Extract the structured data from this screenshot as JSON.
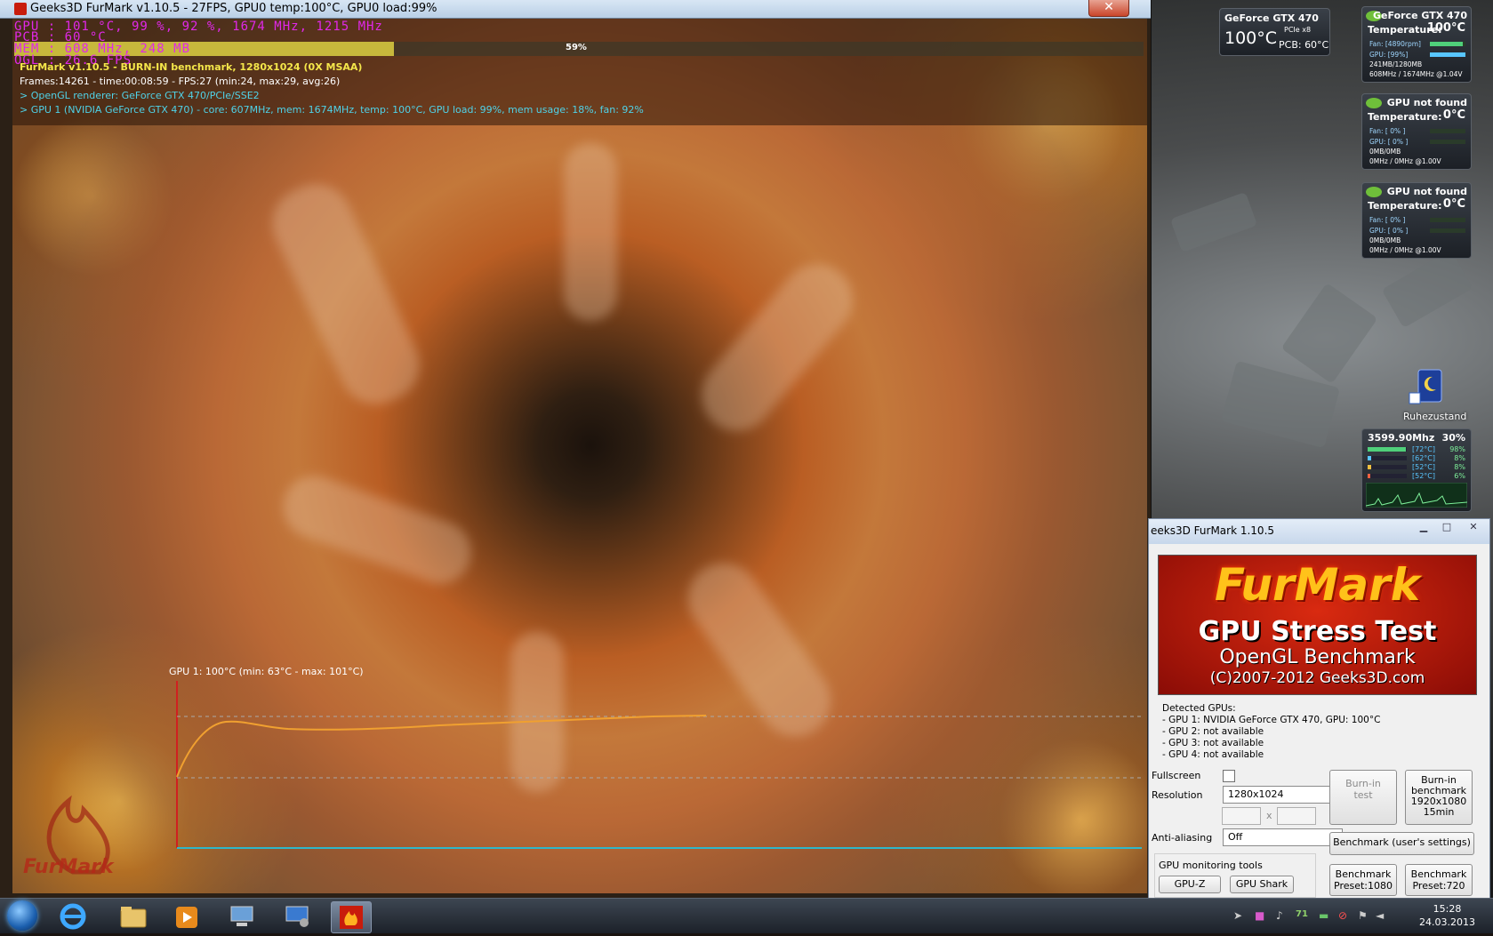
{
  "fm_window": {
    "title": "Geeks3D FurMark v1.10.5 - 27FPS, GPU0 temp:100°C, GPU0 load:99%",
    "close": "✕"
  },
  "osd": {
    "gpu": "GPU   :  101 °C,  99 %,  92 %,  1674 MHz,  1215 MHz",
    "pcb": "PCB   :  60 °C",
    "mem": "MEM   :  608 MHz,  248 MB",
    "mem_pct_label": "59%",
    "mem_pct": 59,
    "ogl": "OGL   :  26.6 FPS"
  },
  "info": {
    "line1": "FurMark v1.10.5 - BURN-IN benchmark, 1280x1024 (0X MSAA)",
    "line2": "Frames:14261 - time:00:08:59 - FPS:27 (min:24, max:29, avg:26)",
    "line3": "> OpenGL renderer: GeForce GTX 470/PCIe/SSE2",
    "line4": "> GPU 1 (NVIDIA GeForce GTX 470) - core: 607MHz, mem: 1674MHz, temp: 100°C, GPU load: 99%, mem usage: 18%, fan: 92%"
  },
  "graph": {
    "title": "GPU 1: 100°C (min: 63°C - max: 101°C)"
  },
  "watermark": "FurMark",
  "gadget_small": {
    "name": "GeForce GTX 470",
    "temp": "100°C",
    "pcie": "PCIe x8",
    "pcb": "PCB: 60°C"
  },
  "gadgets_nv": [
    {
      "title": "GeForce GTX 470",
      "temp_label": "Temperature:",
      "temp": "100°C",
      "fan": "Fan: [4890rpm]",
      "gpu": "GPU: [99%]",
      "mem": "241MB/1280MB",
      "clock": "608MHz / 1674MHz @1.04V",
      "fan_level": 0.92,
      "gpu_level": 0.99,
      "mem_level": 0.19
    },
    {
      "title": "GPU not found",
      "temp_label": "Temperature:",
      "temp": "0°C",
      "fan": "Fan: [ 0% ]",
      "gpu": "GPU: [ 0% ]",
      "mem": "0MB/0MB",
      "clock": "0MHz / 0MHz @1.00V",
      "fan_level": 0,
      "gpu_level": 0,
      "mem_level": 0
    },
    {
      "title": "GPU not found",
      "temp_label": "Temperature:",
      "temp": "0°C",
      "fan": "Fan: [ 0% ]",
      "gpu": "GPU: [ 0% ]",
      "mem": "0MB/0MB",
      "clock": "0MHz / 0MHz @1.00V",
      "fan_level": 0,
      "gpu_level": 0,
      "mem_level": 0
    }
  ],
  "desktop_icon": {
    "label": "Ruhezustand"
  },
  "cpu_gadget": {
    "freq": "3599.90Mhz",
    "load": "30%",
    "cores": [
      {
        "temp": "[72°C]",
        "load": "98%",
        "level": 0.98
      },
      {
        "temp": "[62°C]",
        "load": "8%",
        "level": 0.08
      },
      {
        "temp": "[52°C]",
        "load": "8%",
        "level": 0.08
      },
      {
        "temp": "[52°C]",
        "load": "6%",
        "level": 0.06
      }
    ]
  },
  "dialog": {
    "title": "eeks3D FurMark 1.10.5",
    "banner_1": "FurMark",
    "banner_2": "GPU Stress Test",
    "banner_3": "OpenGL Benchmark",
    "banner_4": "(C)2007-2012 Geeks3D.com",
    "detected_header": "Detected GPUs:",
    "gpus": [
      "- GPU 1: NVIDIA GeForce GTX 470, GPU: 100°C",
      "- GPU 2: not available",
      "- GPU 3: not available",
      "- GPU 4: not available"
    ],
    "fullscreen_label": "Fullscreen",
    "resolution_label": "Resolution",
    "resolution_value": "1280x1024",
    "x_sep": "x",
    "aa_label": "Anti-aliasing",
    "aa_value": "Off",
    "burnin_test": "Burn-in\ntest",
    "burnin_bench": "Burn-in\nbenchmark\n1920x1080\n15min",
    "bench_user": "Benchmark (user's settings)",
    "monitor_label": "GPU monitoring tools",
    "gpuz": "GPU-Z",
    "gpushark": "GPU Shark",
    "preset_1080": "Benchmark\nPreset:1080",
    "preset_720": "Benchmark\nPreset:720"
  },
  "taskbar": {
    "time": "15:28",
    "date": "24.03.2013",
    "tray_temp": "71"
  },
  "colors": {
    "osd_magenta": "#e028e8",
    "info_yellow": "#f4e64a",
    "info_white": "#ffffff",
    "info_cyan": "#4fd2e8",
    "graph_orange": "#f0a030"
  }
}
